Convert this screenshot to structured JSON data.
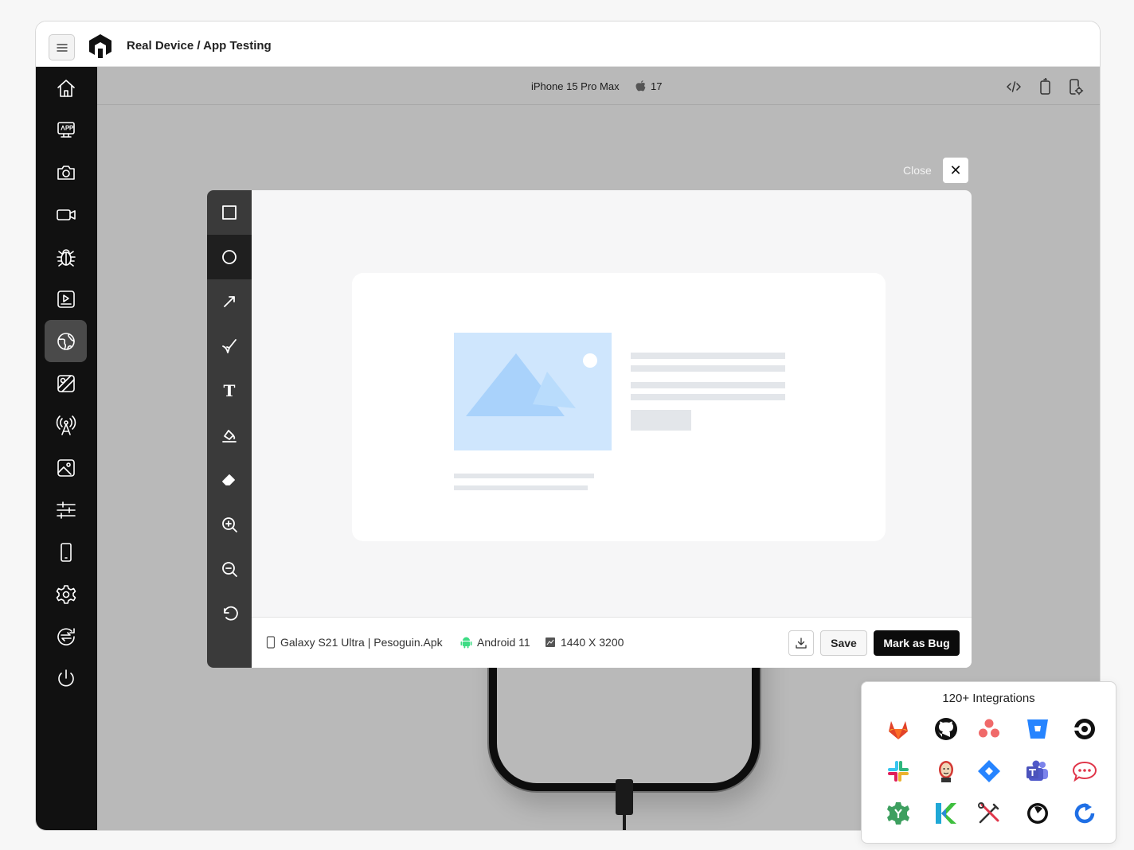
{
  "app": {
    "title": "Real Device / App Testing"
  },
  "sidebar": {
    "items": [
      {
        "name": "home-icon"
      },
      {
        "name": "app-icon"
      },
      {
        "name": "camera-icon"
      },
      {
        "name": "video-icon"
      },
      {
        "name": "bug-icon"
      },
      {
        "name": "screen-play-icon"
      },
      {
        "name": "globe-icon",
        "active": true
      },
      {
        "name": "geolocation-icon"
      },
      {
        "name": "network-tower-icon"
      },
      {
        "name": "image-icon"
      },
      {
        "name": "sliders-icon"
      },
      {
        "name": "phone-icon"
      },
      {
        "name": "settings-icon"
      },
      {
        "name": "switch-icon"
      },
      {
        "name": "power-icon"
      }
    ]
  },
  "device": {
    "name": "iPhone 15 Pro Max",
    "os_version": "17"
  },
  "editor": {
    "close_label": "Close",
    "tools": [
      "rectangle-icon",
      "circle-icon",
      "arrow-icon",
      "pen-icon",
      "text-tool-icon",
      "fill-icon",
      "eraser-icon",
      "zoom-in-icon",
      "zoom-out-icon",
      "undo-icon"
    ],
    "active_tool": "circle-icon",
    "text_tool_letter": "T",
    "footer": {
      "device_app": "Galaxy S21 Ultra | Pesoguin.Apk",
      "os": "Android 11",
      "resolution": "1440 X 3200",
      "save_label": "Save",
      "mark_bug_label": "Mark as Bug"
    }
  },
  "integrations": {
    "title": "120+ Integrations",
    "icons": [
      "gitlab-icon",
      "github-icon",
      "asana-icon",
      "bitbucket-icon",
      "circleci-icon",
      "slack-icon",
      "jenkins-icon",
      "jira-icon",
      "teams-icon",
      "rocketchat-icon",
      "settings-gear-icon",
      "kotlin-icon",
      "tools-icon",
      "timer-icon",
      "refresh-icon"
    ]
  },
  "colors": {
    "sidebar": "#111111",
    "stage": "#b9b9b9",
    "accent": "#0b0b0b",
    "placeholder_image": "#cfe6fd"
  }
}
